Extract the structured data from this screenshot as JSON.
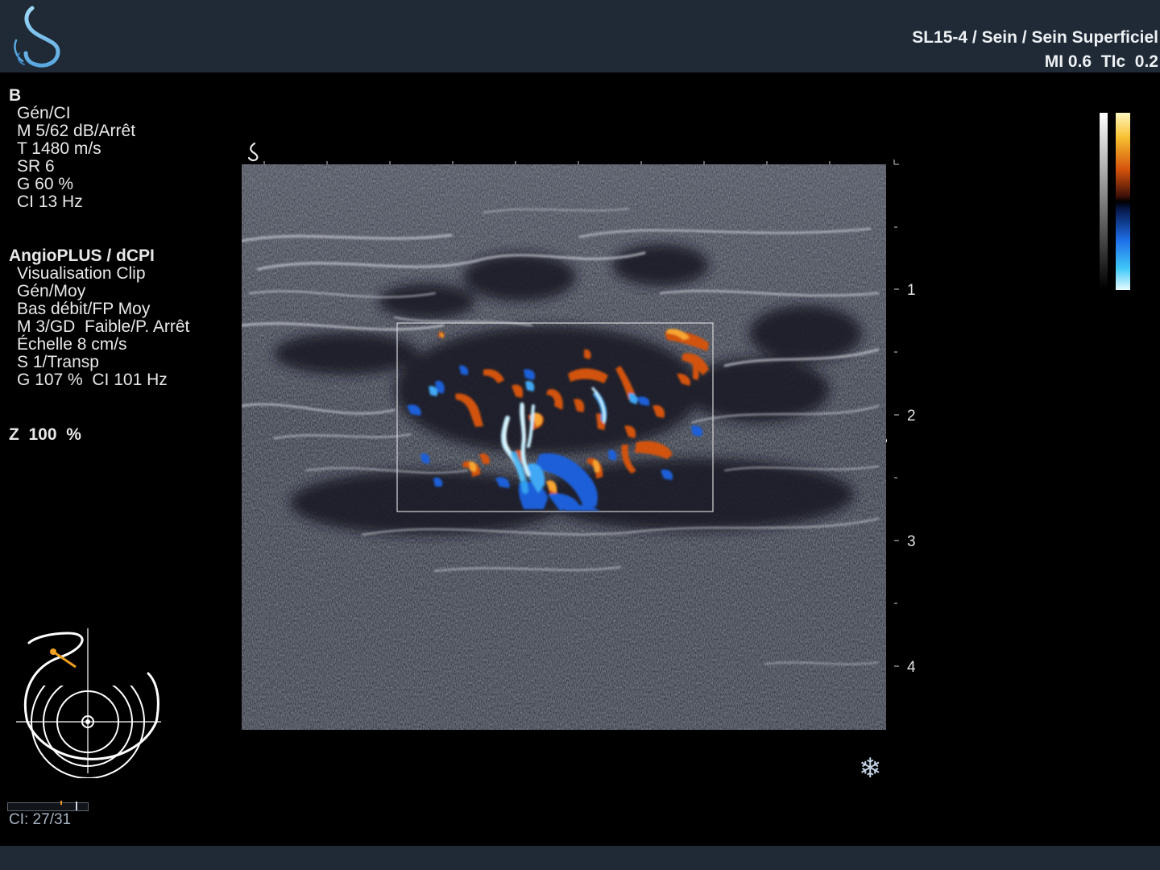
{
  "header": {
    "probe_preset": "SL15-4 / Sein / Sein Superficiel",
    "mi_label": "MI",
    "mi_value": "0.6",
    "tic_label": "TIc",
    "tic_value": "0.2"
  },
  "bmode": {
    "title": "B",
    "lines": [
      "Gén/CI",
      "M 5/62 dB/Arrêt",
      "T 1480 m/s",
      "SR 6",
      "G 60 %",
      "CI 13 Hz"
    ]
  },
  "doppler": {
    "title": "AngioPLUS / dCPI",
    "lines": [
      "Visualisation Clip",
      "Gén/Moy",
      "Bas débit/FP Moy",
      "M 3/GD  Faible/P. Arrêt",
      "Échelle 8 cm/s",
      "S 1/Transp",
      "G 107 %  CI 101 Hz"
    ]
  },
  "zoom": {
    "text": "Z  100  %"
  },
  "depth_scale": {
    "labels": [
      "1",
      "2",
      "3",
      "4"
    ]
  },
  "cine": {
    "label": "CI: 27/31",
    "current_frame": 27,
    "total_frames": 31
  },
  "icons": {
    "logo": "supersonic-s-logo",
    "probe_marker": "probe-orientation-s-icon",
    "freeze": "snowflake-icon",
    "freeze_glyph": "❄",
    "diagram": "probe-position-diagram"
  },
  "colors": {
    "header_bg": "#1f2a36",
    "logo_blue": "#7fc4ee",
    "doppler_red": "#d4520c",
    "doppler_blue": "#1e6fe8",
    "accent_orange": "#f0a020"
  }
}
